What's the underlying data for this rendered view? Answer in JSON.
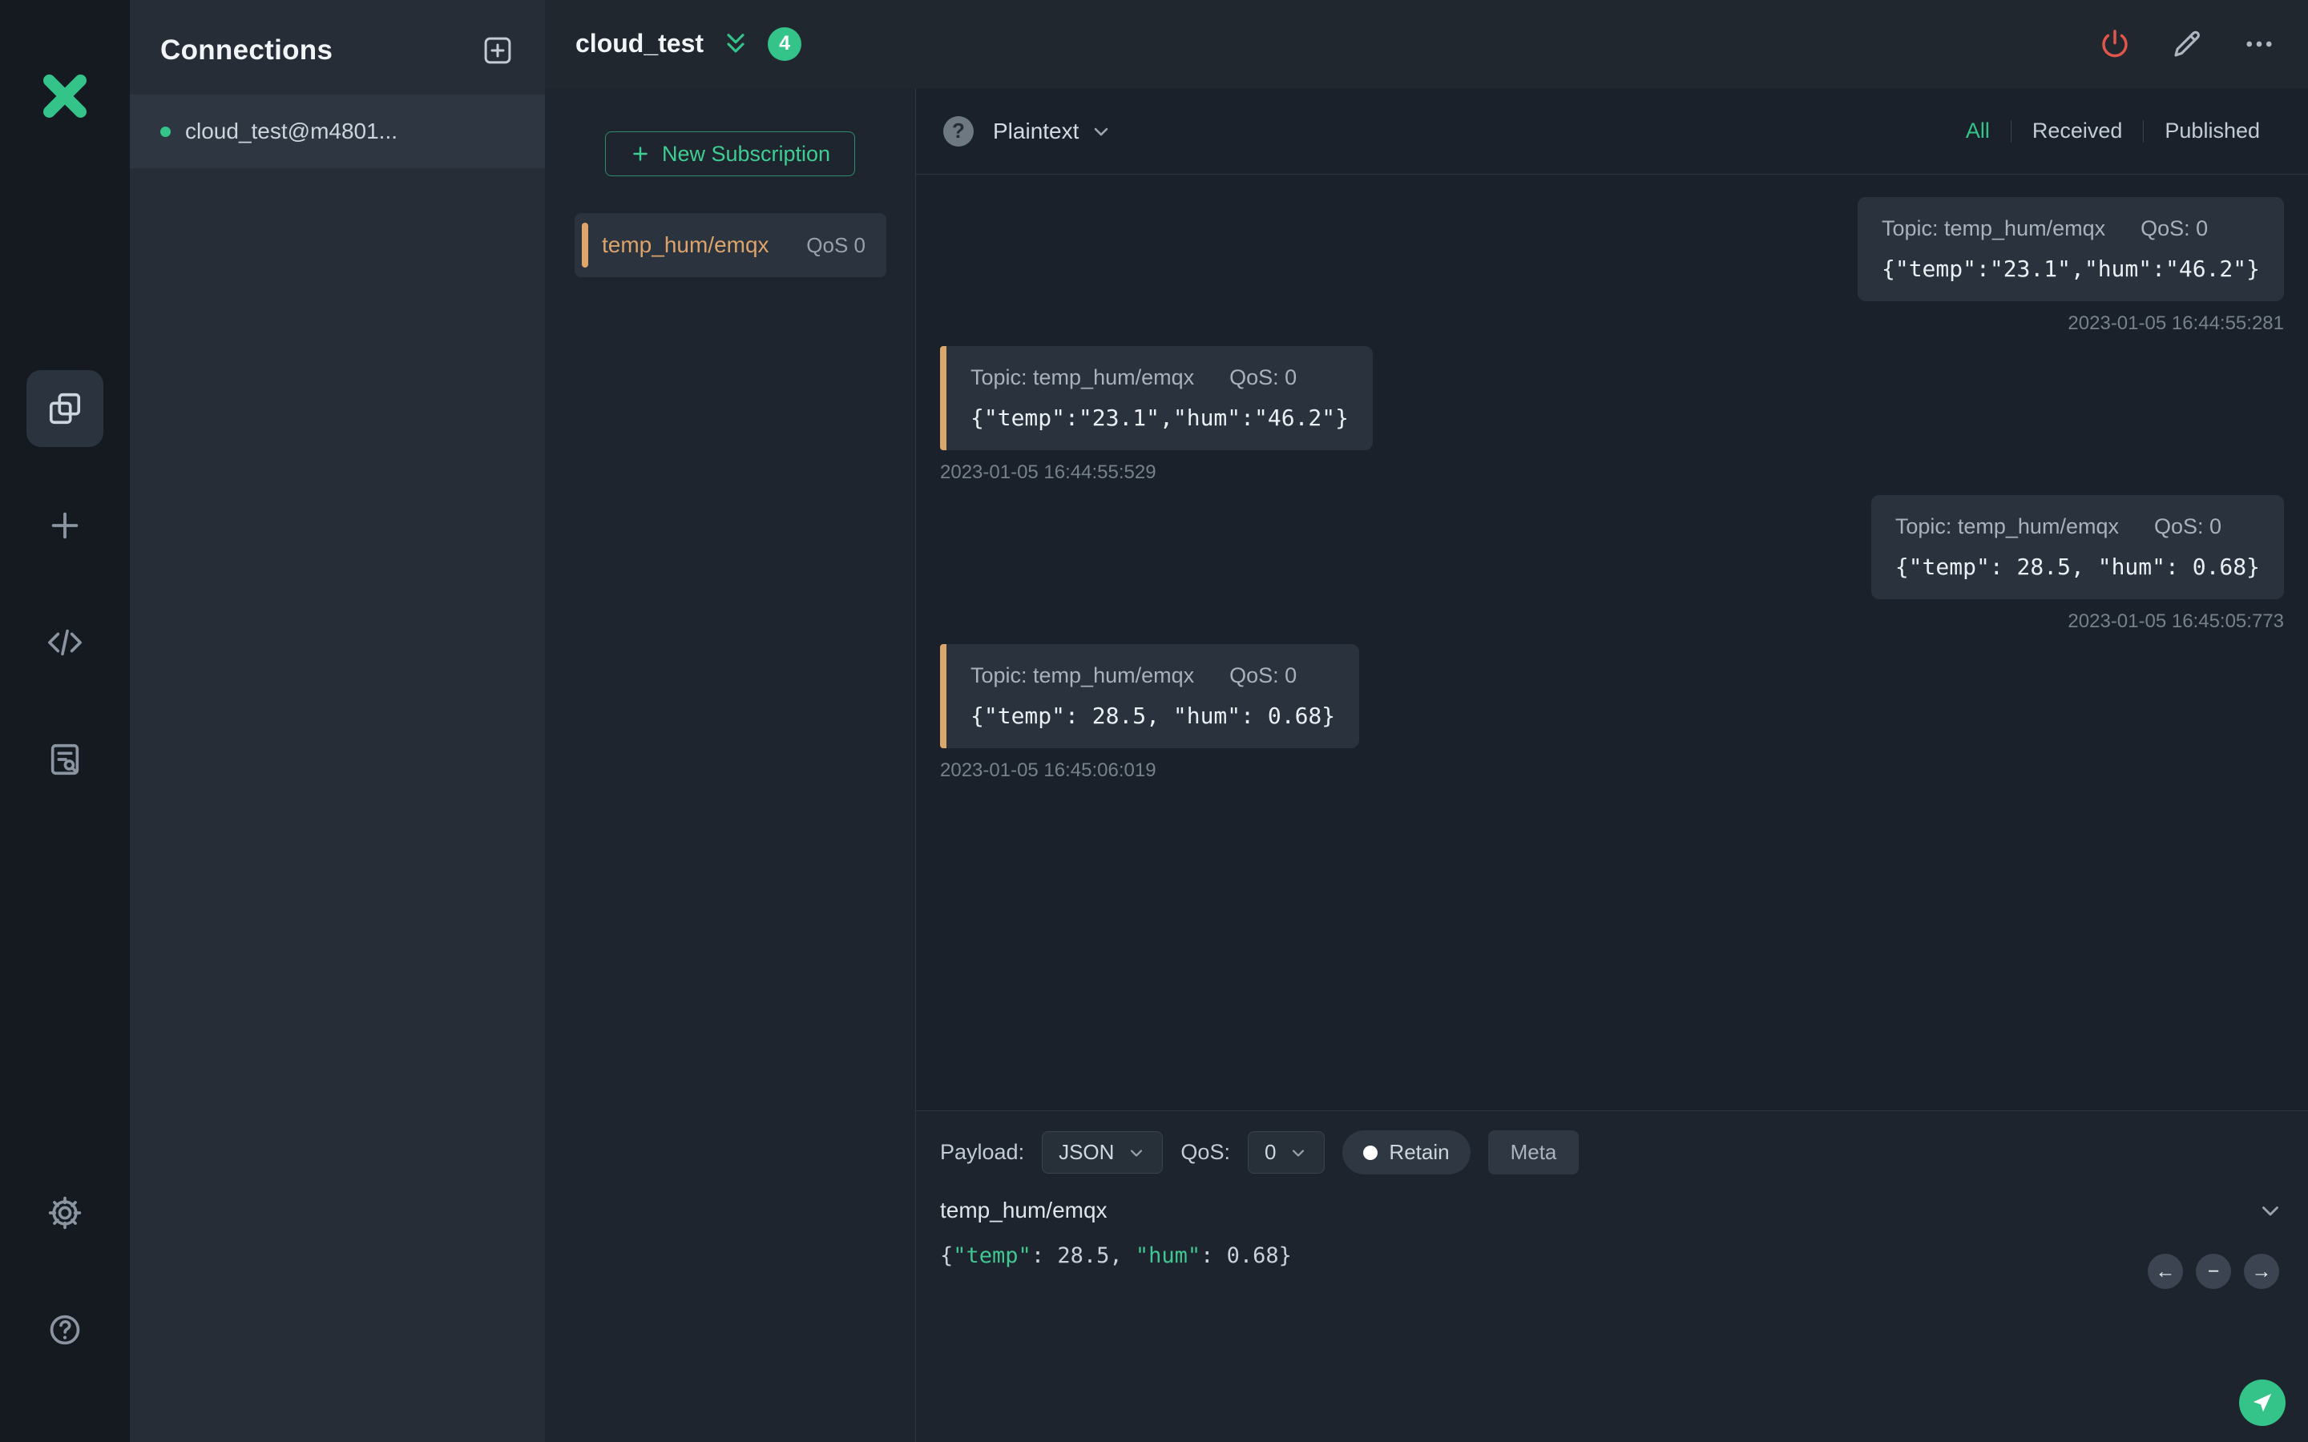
{
  "colors": {
    "accent_green": "#34c388",
    "accent_orange": "#dfa76b",
    "power_red": "#e0564a"
  },
  "connections_panel": {
    "title": "Connections",
    "items": [
      {
        "label": "cloud_test@m4801...",
        "selected": true
      }
    ]
  },
  "topbar": {
    "title": "cloud_test",
    "badge_count": "4"
  },
  "subscriptions": {
    "new_button_label": "New Subscription",
    "items": [
      {
        "topic": "temp_hum/emqx",
        "qos": "QoS 0"
      }
    ]
  },
  "message_toolbar": {
    "format": "Plaintext",
    "help_glyph": "?",
    "filters": [
      {
        "label": "All",
        "active": true
      },
      {
        "label": "Received",
        "active": false
      },
      {
        "label": "Published",
        "active": false
      }
    ]
  },
  "messages": [
    {
      "direction": "published",
      "topic": "Topic: temp_hum/emqx",
      "qos": "QoS: 0",
      "payload": "{\"temp\":\"23.1\",\"hum\":\"46.2\"}",
      "timestamp": "2023-01-05 16:44:55:281"
    },
    {
      "direction": "received",
      "topic": "Topic: temp_hum/emqx",
      "qos": "QoS: 0",
      "payload": "{\"temp\":\"23.1\",\"hum\":\"46.2\"}",
      "timestamp": "2023-01-05 16:44:55:529"
    },
    {
      "direction": "published",
      "topic": "Topic: temp_hum/emqx",
      "qos": "QoS: 0",
      "payload": "{\"temp\": 28.5, \"hum\": 0.68}",
      "timestamp": "2023-01-05 16:45:05:773"
    },
    {
      "direction": "received",
      "topic": "Topic: temp_hum/emqx",
      "qos": "QoS: 0",
      "payload": "{\"temp\": 28.5, \"hum\": 0.68}",
      "timestamp": "2023-01-05 16:45:06:019"
    }
  ],
  "publish": {
    "payload_label": "Payload:",
    "format_value": "JSON",
    "qos_label": "QoS:",
    "qos_value": "0",
    "retain_label": "Retain",
    "meta_label": "Meta",
    "topic_value": "temp_hum/emqx",
    "editor_tokens": [
      {
        "text": "{",
        "type": "plain"
      },
      {
        "text": "\"temp\"",
        "type": "key"
      },
      {
        "text": ": 28.5, ",
        "type": "plain"
      },
      {
        "text": "\"hum\"",
        "type": "key"
      },
      {
        "text": ": 0.68}",
        "type": "plain"
      }
    ],
    "pager": {
      "prev": "←",
      "count": "−",
      "next": "→"
    }
  }
}
